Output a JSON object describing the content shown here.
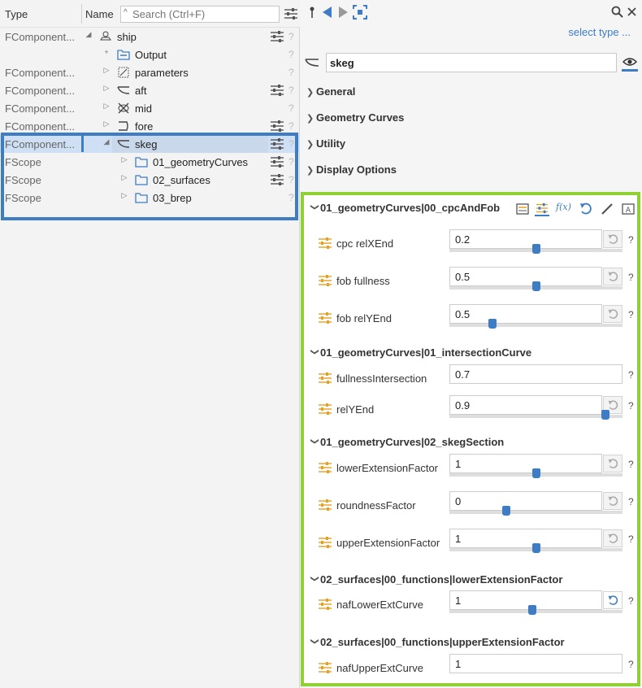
{
  "tree": {
    "header": {
      "type_label": "Type",
      "name_label": "Name",
      "search_placeholder": "Search (Ctrl+F)"
    },
    "rows": [
      {
        "type": "FComponent...",
        "toggle": "◢",
        "icon": "ship-icon",
        "label": "ship",
        "adj": true
      },
      {
        "type": "",
        "toggle": "+",
        "icon": "output-folder-icon",
        "label": "Output",
        "adj": false
      },
      {
        "type": "FComponent...",
        "toggle": "▷",
        "icon": "parameters-icon",
        "label": "parameters",
        "adj": false
      },
      {
        "type": "FComponent...",
        "toggle": "▷",
        "icon": "aft-icon",
        "label": "aft",
        "adj": true
      },
      {
        "type": "FComponent...",
        "toggle": "▷",
        "icon": "mid-icon",
        "label": "mid",
        "adj": false
      },
      {
        "type": "FComponent...",
        "toggle": "▷",
        "icon": "fore-icon",
        "label": "fore",
        "adj": true
      },
      {
        "type": "FComponent...",
        "toggle": "◢",
        "icon": "skeg-icon",
        "label": "skeg",
        "adj": true
      },
      {
        "type": "FScope",
        "toggle": "▷",
        "icon": "folder-icon",
        "label": "01_geometryCurves",
        "adj": true
      },
      {
        "type": "FScope",
        "toggle": "▷",
        "icon": "folder-icon",
        "label": "02_surfaces",
        "adj": true
      },
      {
        "type": "FScope",
        "toggle": "▷",
        "icon": "folder-icon",
        "label": "03_brep",
        "adj": false
      }
    ]
  },
  "inspector": {
    "select_type": "select type ...",
    "name_value": "skeg",
    "sections": [
      "General",
      "Geometry Curves",
      "Utility",
      "Display Options"
    ],
    "groups": [
      {
        "title": "01_geometryCurves|00_cpcAndFob",
        "params": [
          {
            "label": "cpc relXEnd",
            "value": "0.2",
            "slider": 0.5,
            "reset": true
          },
          {
            "label": "fob fullness",
            "value": "0.5",
            "slider": 0.5,
            "reset": true
          },
          {
            "label": "fob relYEnd",
            "value": "0.5",
            "slider": 0.25,
            "reset": true
          }
        ]
      },
      {
        "title": "01_geometryCurves|01_intersectionCurve",
        "params": [
          {
            "label": "fullnessIntersection",
            "value": "0.7",
            "slider": null,
            "reset": false
          },
          {
            "label": "relYEnd",
            "value": "0.9",
            "slider": 0.9,
            "reset": true
          }
        ]
      },
      {
        "title": "01_geometryCurves|02_skegSection",
        "params": [
          {
            "label": "lowerExtensionFactor",
            "value": "1",
            "slider": 0.5,
            "reset": true
          },
          {
            "label": "roundnessFactor",
            "value": "0",
            "slider": 0.33,
            "reset": true
          },
          {
            "label": "upperExtensionFactor",
            "value": "1",
            "slider": 0.5,
            "reset": true
          }
        ]
      },
      {
        "title": "02_surfaces|00_functions|lowerExtensionFactor",
        "params": [
          {
            "label": "nafLowerExtCurve",
            "value": "1",
            "slider": 0.48,
            "reset": true,
            "reset_active": true
          }
        ]
      },
      {
        "title": "02_surfaces|00_functions|upperExtensionFactor",
        "params": [
          {
            "label": "nafUpperExtCurve",
            "value": "1",
            "slider": null,
            "reset": false
          }
        ]
      }
    ],
    "help": "?"
  },
  "colors": {
    "accent": "#3e7cc4",
    "highlight_green": "#8fd032",
    "adjust_icon": "#e8a020"
  }
}
